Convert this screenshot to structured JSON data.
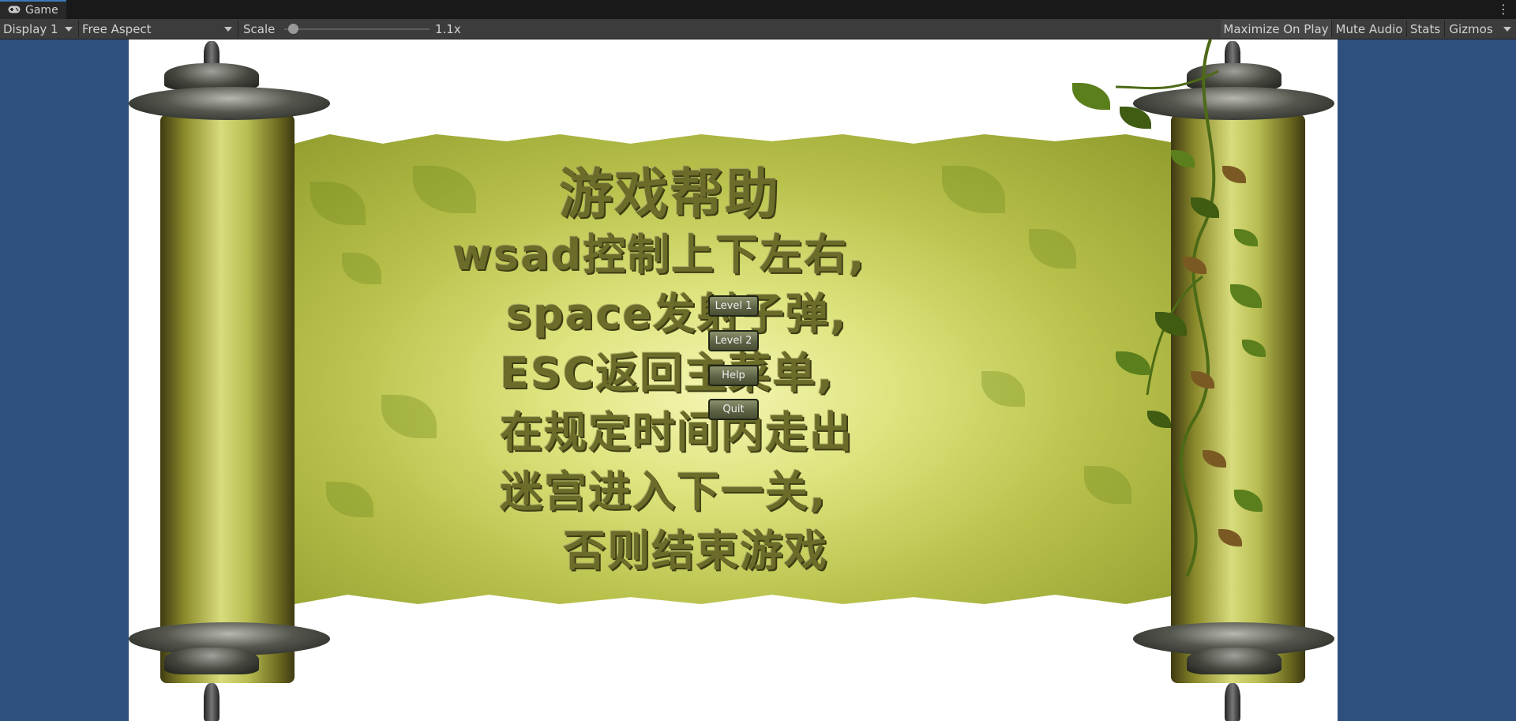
{
  "window": {
    "tab_icon": "gamepad-icon",
    "tab_title": "Game",
    "menu_icon": "kebab-menu-icon"
  },
  "toolbar": {
    "display_label": "Display 1",
    "aspect_label": "Free Aspect",
    "scale_label": "Scale",
    "scale_value": "1.1x",
    "maximize_label": "Maximize On Play",
    "mute_label": "Mute Audio",
    "stats_label": "Stats",
    "gizmos_label": "Gizmos"
  },
  "game": {
    "help_title": "游戏帮助",
    "help_lines": [
      "wsad控制上下左右,",
      "space发射子弹,",
      "ESC返回主菜单,",
      "在规定时间内走出",
      "迷宫进入下一关,",
      "否则结束游戏"
    ],
    "buttons": [
      "Level 1",
      "Level 2",
      "Help",
      "Quit"
    ]
  },
  "colors": {
    "editor_background": "#2f4f7f",
    "toolbar": "#3c3c3c",
    "titlebar": "#191919"
  }
}
